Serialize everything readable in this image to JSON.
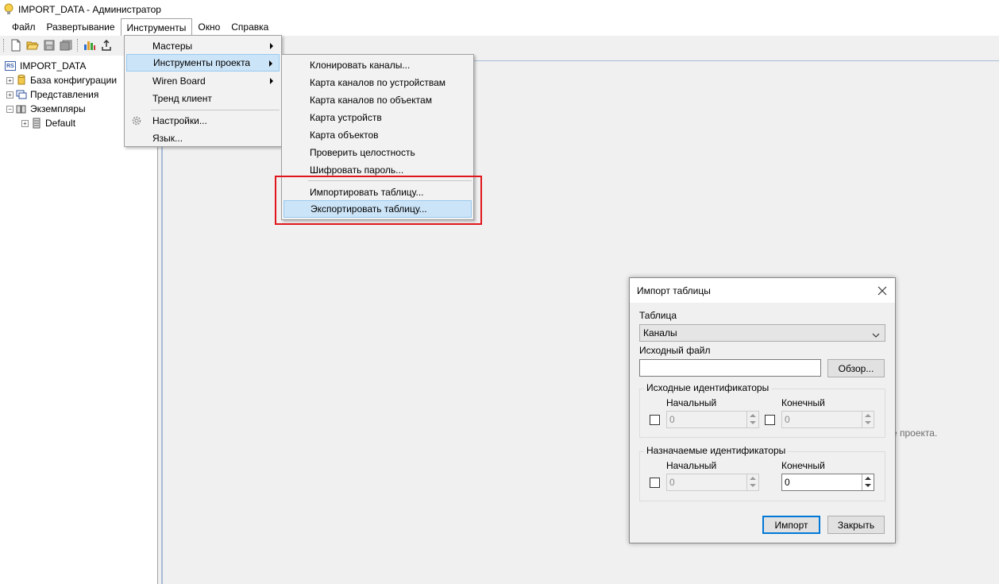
{
  "window": {
    "title": "IMPORT_DATA - Администратор"
  },
  "menubar": {
    "items": [
      "Файл",
      "Развертывание",
      "Инструменты",
      "Окно",
      "Справка"
    ]
  },
  "tree": {
    "root": {
      "badge": "RS",
      "label": "IMPORT_DATA"
    },
    "items": [
      {
        "label": "База конфигурации",
        "expander": "+"
      },
      {
        "label": "Представления",
        "expander": "+"
      },
      {
        "label": "Экземпляры",
        "expander": "−"
      },
      {
        "label": "Default",
        "expander": "+"
      }
    ]
  },
  "tools_menu": {
    "items": [
      "Мастеры",
      "Инструменты проекта",
      "Wiren Board",
      "Тренд клиент",
      "Настройки...",
      "Язык..."
    ]
  },
  "project_tools_menu": {
    "items": [
      "Клонировать каналы...",
      "Карта каналов по устройствам",
      "Карта каналов по объектам",
      "Карта устройств",
      "Карта объектов",
      "Проверить целостность",
      "Шифровать пароль...",
      "Импортировать таблицу...",
      "Экспортировать таблицу..."
    ]
  },
  "background_hint": "е проекта.",
  "dialog": {
    "title": "Импорт таблицы",
    "table_label": "Таблица",
    "table_value": "Каналы",
    "source_file_label": "Исходный файл",
    "source_file_value": "",
    "browse_label": "Обзор...",
    "source_ids": {
      "title": "Исходные идентификаторы",
      "start_label": "Начальный",
      "end_label": "Конечный",
      "start_value": "0",
      "end_value": "0"
    },
    "target_ids": {
      "title": "Назначаемые идентификаторы",
      "start_label": "Начальный",
      "end_label": "Конечный",
      "start_value": "0",
      "end_value": "0"
    },
    "import_label": "Импорт",
    "close_label": "Закрыть"
  },
  "colors": {
    "highlight_bg": "#cce4f7",
    "highlight_border": "#99c9ef",
    "red_box": "#e0161c",
    "accent_blue": "#0078d7"
  }
}
